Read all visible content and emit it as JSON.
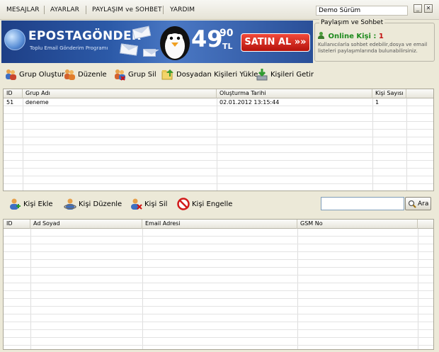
{
  "menu": {
    "items": [
      "MESAJLAR",
      "AYARLAR",
      "PAYLAŞIM ve SOHBET",
      "YARDIM"
    ],
    "status": "Demo Sürüm"
  },
  "banner": {
    "logo_text": "EPOSTAGÖNDER",
    "logo_sub": "Toplu Email Gönderim Programı",
    "price_main": "49",
    "price_cents": "90",
    "currency": "TL",
    "buy_label": "SATIN AL »»"
  },
  "share": {
    "title": "Paylaşım ve Sohbet",
    "online_label": "Online Kişi :",
    "online_count": "1",
    "description": "Kullanıcılarla sohbet edebilir,dosya ve email listeleri paylaşımlarında bulunabilirsiniz."
  },
  "group_toolbar": {
    "create": "Grup Oluştur",
    "edit": "Düzenle",
    "delete": "Grup Sil",
    "import": "Dosyadan Kişileri Yükle",
    "fetch": "Kişileri Getir"
  },
  "group_table": {
    "columns": [
      "ID",
      "Grup Adı",
      "Oluşturma Tarihi",
      "Kişi Sayısı"
    ],
    "rows": [
      {
        "id": "51",
        "name": "deneme",
        "date": "02.01.2012 13:15:44",
        "count": "1"
      }
    ]
  },
  "contact_toolbar": {
    "add": "Kişi Ekle",
    "edit": "Kişi Düzenle",
    "delete": "Kişi Sil",
    "block": "Kişi Engelle",
    "search_placeholder": "",
    "search_label": "Ara"
  },
  "contact_table": {
    "columns": [
      "ID",
      "Ad Soyad",
      "Email Adresi",
      "GSM No"
    ],
    "rows": []
  },
  "colors": {
    "online": "#1c8a1c",
    "buy_button": "#d42318",
    "banner": "#2c5aa8"
  }
}
